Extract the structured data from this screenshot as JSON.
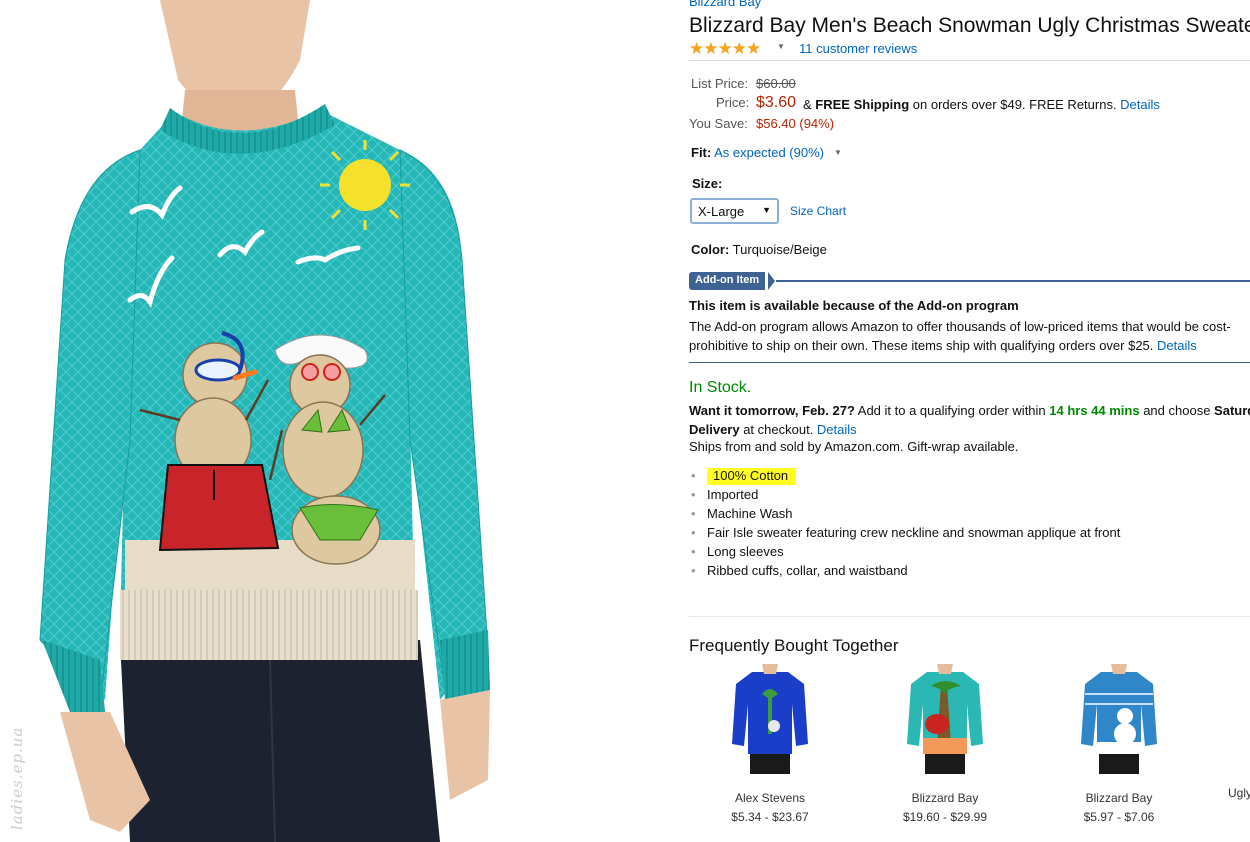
{
  "product": {
    "brand": "Blizzard Bay",
    "title": "Blizzard Bay Men's Beach Snowman Ugly Christmas Sweater",
    "stars": "★★★★★",
    "reviews": "11 customer reviews"
  },
  "pricing": {
    "list_label": "List Price:",
    "list_price": "$60.00",
    "price_label": "Price:",
    "price": "$3.60",
    "shipping_pre": "& ",
    "shipping_bold": "FREE Shipping",
    "shipping_post": " on orders over $49. FREE Returns. ",
    "shipping_link": "Details",
    "save_label": "You Save:",
    "save_value": "$56.40 (94%)"
  },
  "fit": {
    "label": "Fit:",
    "value": "As expected (90%)"
  },
  "size": {
    "label": "Size:",
    "selected": "X-Large",
    "chart_link": "Size Chart"
  },
  "color": {
    "label": "Color:",
    "value": "Turquoise/Beige"
  },
  "addon": {
    "badge": "Add-on Item",
    "title": "This item is available because of the Add-on program",
    "text": "The Add-on program allows Amazon to offer thousands of low-priced items that would be cost-prohibitive to ship on their own. These items ship with qualifying orders over $25. ",
    "link": "Details"
  },
  "availability": {
    "stock": "In Stock.",
    "want_bold": "Want it tomorrow, Feb. 27?",
    "want_text": " Add it to a qualifying order within ",
    "countdown": "14 hrs 44 mins",
    "choose_text": " and choose ",
    "choose_bold": "Saturday Delivery",
    "checkout_text": " at checkout. ",
    "details_link": "Details",
    "ships": "Ships from and sold by Amazon.com. Gift-wrap available."
  },
  "features": [
    "100% Cotton",
    "Imported",
    "Machine Wash",
    "Fair Isle sweater featuring crew neckline and snowman applique at front",
    "Long sleeves",
    "Ribbed cuffs, collar, and waistband"
  ],
  "fbt": {
    "title": "Frequently Bought Together",
    "items": [
      {
        "name": "Alex Stevens",
        "price": "$5.34 - $23.67"
      },
      {
        "name": "Blizzard Bay",
        "price": "$19.60 - $29.99"
      },
      {
        "name": "Blizzard Bay",
        "price": "$5.97 - $7.06"
      },
      {
        "name": "Ugly"
      }
    ]
  },
  "watermark": "ladies.ep.ua",
  "colors": {
    "sweater_teal": "#24b7b5",
    "price_red": "#b12704",
    "stock_green": "#008a00",
    "link_blue": "#0066c0",
    "addon_blue": "#3e6393",
    "highlight_yellow": "#ffff22"
  }
}
